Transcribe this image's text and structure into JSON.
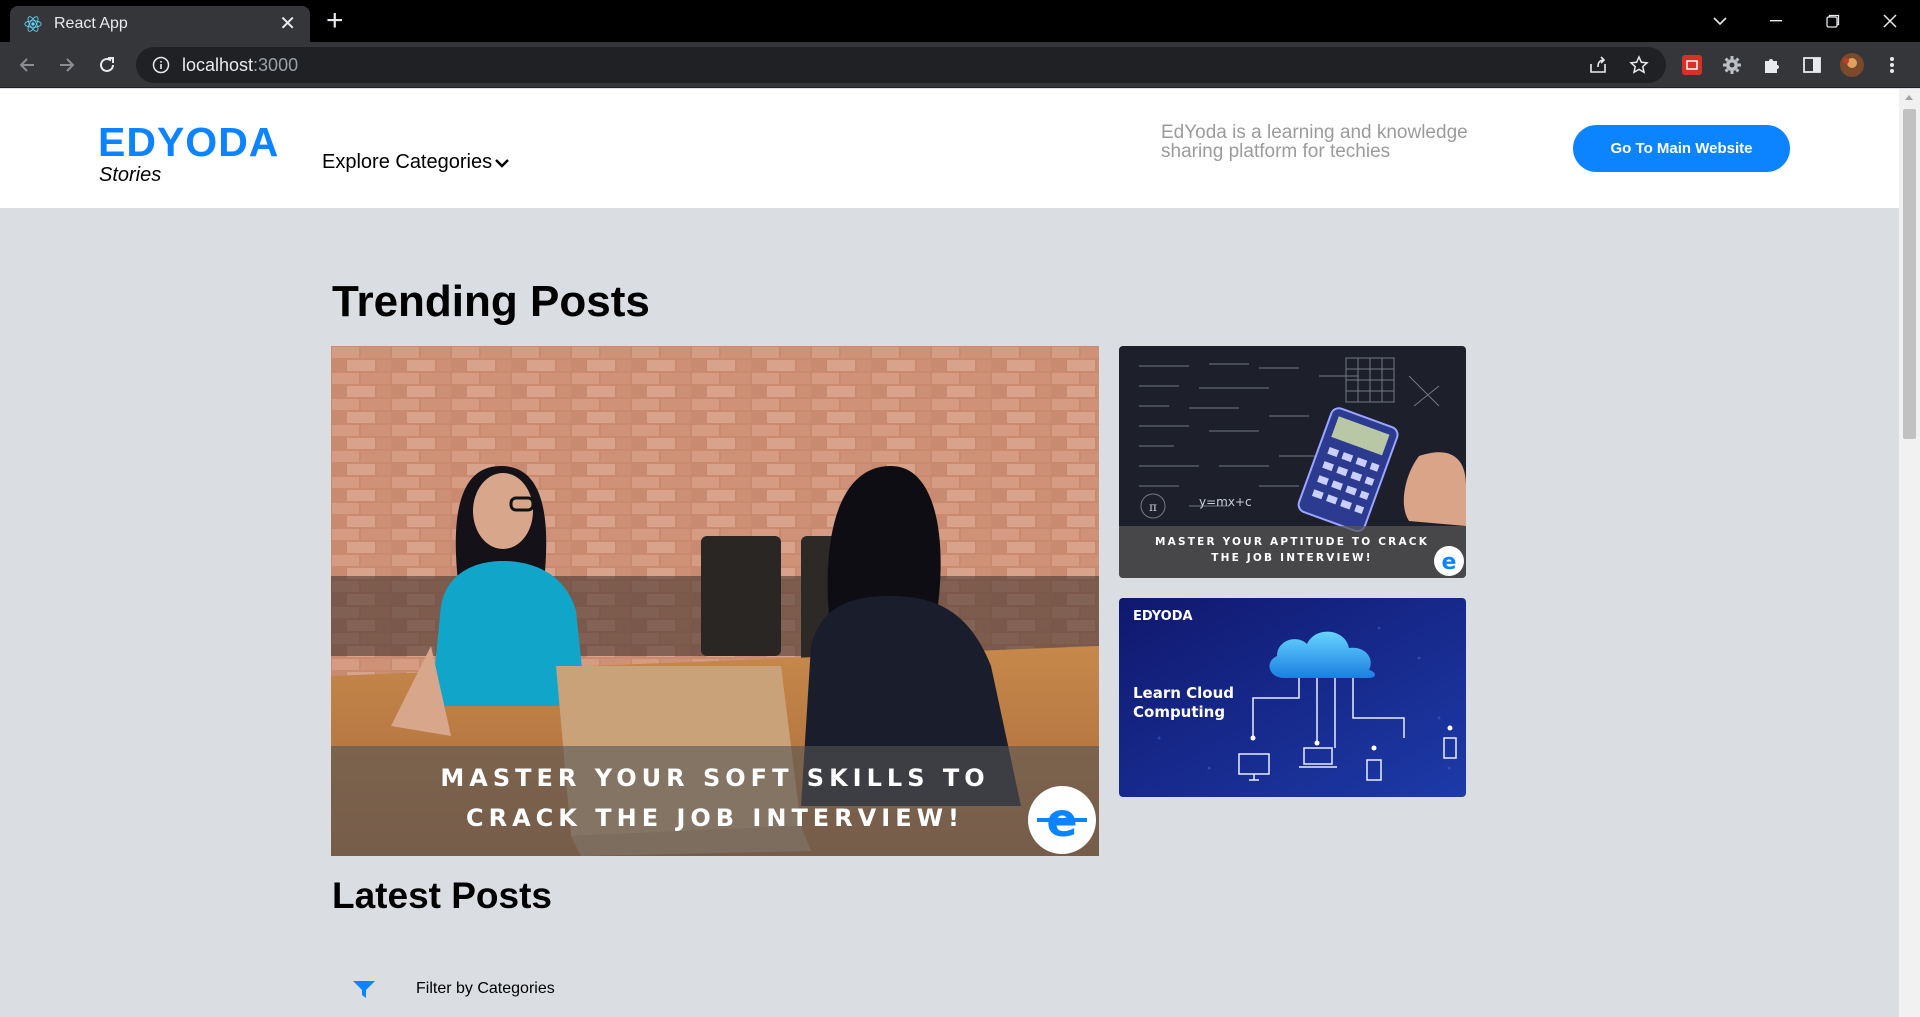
{
  "browser": {
    "tab_title": "React App",
    "url_host": "localhost",
    "url_port": ":3000"
  },
  "header": {
    "logo": "EDYODA",
    "logo_sub": "Stories",
    "explore_label": "Explore Categories",
    "tagline": "EdYoda is a learning and knowledge sharing platform for techies",
    "main_button": "Go To Main Website"
  },
  "trending": {
    "title": "Trending Posts",
    "hero_line1": "MASTER YOUR SOFT SKILLS TO",
    "hero_line2": "CRACK THE JOB INTERVIEW!",
    "side1_line1": "MASTER YOUR APTITUDE TO CRACK",
    "side1_line2": "THE JOB INTERVIEW!",
    "side2_brand": "EDYODA",
    "side2_line1": "Learn Cloud",
    "side2_line2": "Computing"
  },
  "latest": {
    "title": "Latest Posts",
    "filter_label": "Filter by Categories"
  },
  "colors": {
    "accent": "#0d84ff",
    "page_bg": "#dadde2"
  }
}
